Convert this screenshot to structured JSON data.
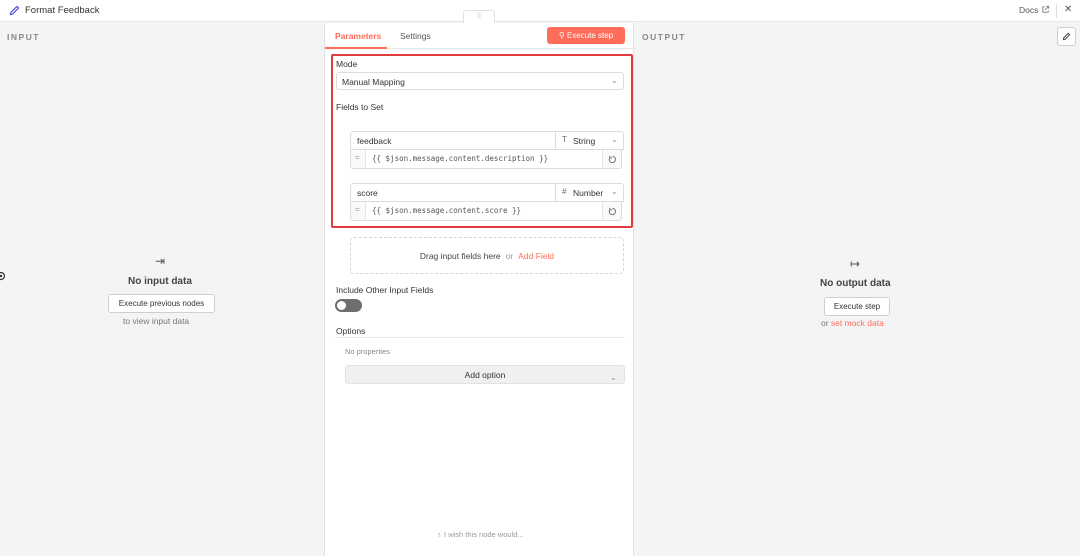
{
  "header": {
    "title": "Format Feedback",
    "title_icon": "pencil-icon",
    "docs_label": "Docs",
    "close_label": "✕"
  },
  "input_panel": {
    "label": "INPUT",
    "empty_title": "No input data",
    "button_label": "Execute previous nodes",
    "sub_text": "to view input data"
  },
  "output_panel": {
    "label": "OUTPUT",
    "empty_title": "No output data",
    "button_label": "Execute step",
    "sub_prefix": "or ",
    "sub_link": "set mock data"
  },
  "center": {
    "tabs": [
      {
        "label": "Parameters",
        "active": true
      },
      {
        "label": "Settings",
        "active": false
      }
    ],
    "execute_label": "Execute step",
    "mode_label": "Mode",
    "mode_value": "Manual Mapping",
    "fields_label": "Fields to Set",
    "fields": [
      {
        "name": "feedback",
        "type": "String",
        "type_icon": "T",
        "expression": "{{ $json.message.content.description }}"
      },
      {
        "name": "score",
        "type": "Number",
        "type_icon": "#",
        "expression": "{{ $json.message.content.score }}"
      }
    ],
    "drop_text": "Drag input fields here",
    "drop_or": "or",
    "drop_add": "Add Field",
    "include_label": "Include Other Input Fields",
    "include_value": false,
    "options_label": "Options",
    "no_properties": "No properties",
    "add_option_label": "Add option",
    "wish_text": "I wish this node would..."
  },
  "colors": {
    "accent": "#ff6d5a",
    "highlight": "#e23b3b",
    "title_icon": "#4b4be0"
  }
}
